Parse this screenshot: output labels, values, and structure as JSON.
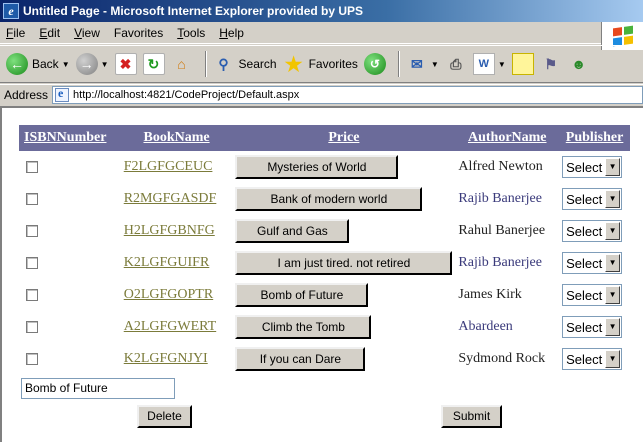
{
  "window": {
    "title": "Untitled Page - Microsoft Internet Explorer provided by UPS"
  },
  "menu": {
    "items": [
      {
        "key": "F",
        "rest": "ile"
      },
      {
        "key": "E",
        "rest": "dit"
      },
      {
        "key": "V",
        "rest": "iew"
      },
      {
        "key": "",
        "rest": "Favorites",
        "ulchar": "a"
      },
      {
        "key": "T",
        "rest": "ools"
      },
      {
        "key": "H",
        "rest": "elp"
      }
    ]
  },
  "toolbar": {
    "back_label": "Back",
    "search_label": "Search",
    "favorites_label": "Favorites"
  },
  "address": {
    "label": "Address",
    "url": "http://localhost:4821/CodeProject/Default.aspx"
  },
  "grid": {
    "headers": {
      "check": "ISBNNumber",
      "isbn": "BookName",
      "price": "Price",
      "author": "AuthorName",
      "publisher": "Publisher"
    },
    "rows": [
      {
        "isbn": "F2LGFGCEUC",
        "book": "Mysteries of World",
        "author": "Alfred Newton",
        "author_link": false,
        "publisher": "Select"
      },
      {
        "isbn": "R2MGFGASDF",
        "book": "Bank of modern world",
        "author": "Rajib Banerjee",
        "author_link": true,
        "publisher": "Select"
      },
      {
        "isbn": "H2LGFGBNFG",
        "book": "Gulf and Gas",
        "author": "Rahul Banerjee",
        "author_link": false,
        "publisher": "Select"
      },
      {
        "isbn": "K2LGFGUIFR",
        "book": "I am just tired. not retired",
        "author": "Rajib Banerjee",
        "author_link": true,
        "publisher": "Select"
      },
      {
        "isbn": "O2LGFGOPTR",
        "book": "Bomb of Future",
        "author": "James Kirk",
        "author_link": false,
        "publisher": "Select"
      },
      {
        "isbn": "A2LGFGWERT",
        "book": "Climb the Tomb",
        "author": "Abardeen",
        "author_link": true,
        "publisher": "Select"
      },
      {
        "isbn": "K2LGFGNJYI",
        "book": "If you can Dare",
        "author": "Sydmond Rock",
        "author_link": false,
        "publisher": "Select"
      }
    ]
  },
  "form": {
    "text_value": "Bomb of Future",
    "delete_label": "Delete",
    "submit_label": "Submit"
  }
}
